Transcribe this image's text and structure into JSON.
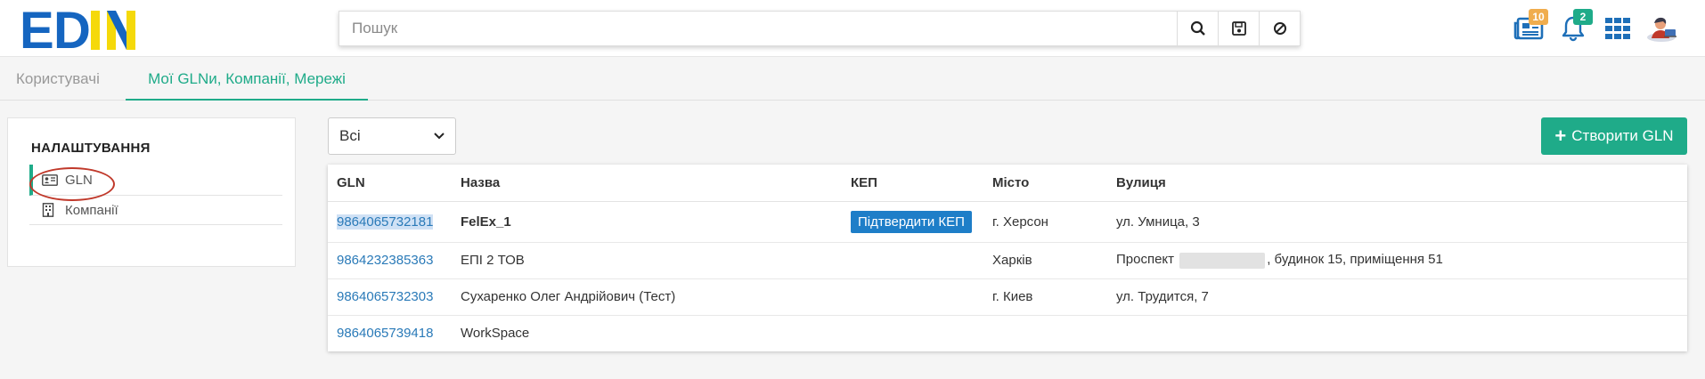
{
  "header": {
    "logo_text": "EDIN",
    "search": {
      "placeholder": "Пошук"
    },
    "icons": [
      "search-icon",
      "save-icon",
      "block-icon"
    ],
    "right": {
      "news_badge": "10",
      "notifications_badge": "2",
      "news_badge_color": "#f0ad4e",
      "notifications_badge_color": "#1fab89"
    }
  },
  "tabs": [
    {
      "label": "Користувачі",
      "active": false
    },
    {
      "label": "Мої GLNи, Компанії, Мережі",
      "active": true
    }
  ],
  "sidebar": {
    "title": "НАЛАШТУВАННЯ",
    "items": [
      {
        "label": "GLN",
        "icon": "id-card-icon",
        "active": true
      },
      {
        "label": "Компанії",
        "icon": "building-icon",
        "active": false
      }
    ]
  },
  "filter": {
    "selected": "Всі"
  },
  "create_button": {
    "label": "Створити GLN"
  },
  "table": {
    "columns": [
      "GLN",
      "Назва",
      "КЕП",
      "Місто",
      "Вулиця"
    ],
    "rows": [
      {
        "gln": "9864065732181",
        "name": "FelEx_1",
        "kep": "Підтвердити КЕП",
        "city": "г. Херсон",
        "street": "ул. Умница, 3"
      },
      {
        "gln": "9864232385363",
        "name": "ЕПІ 2 ТОВ",
        "kep": "",
        "city": "Харків",
        "street_prefix": "Проспект",
        "street_suffix": ", будинок 15, приміщення 51"
      },
      {
        "gln": "9864065732303",
        "name": "Сухаренко Олег Андрійович (Тест)",
        "kep": "",
        "city": "г. Киев",
        "street": "ул. Трудится, 7"
      },
      {
        "gln": "9864065739418",
        "name": "WorkSpace",
        "kep": "",
        "city": "",
        "street": ""
      }
    ]
  },
  "colors": {
    "accent": "#1fab89",
    "link": "#2a7ab8",
    "kep_button": "#1e7ec8",
    "logo_blue": "#1565c0",
    "logo_yellow": "#f5d90a"
  }
}
